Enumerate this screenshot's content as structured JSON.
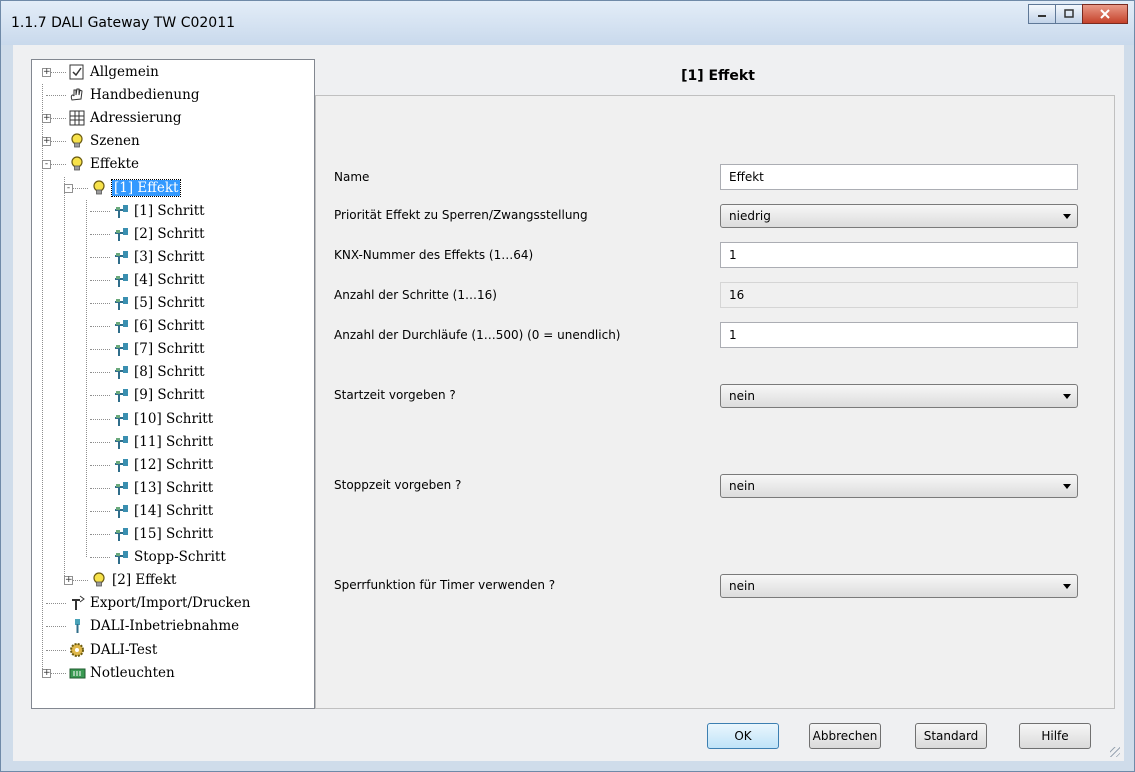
{
  "window": {
    "title": "1.1.7 DALI Gateway TW C02011",
    "controls": [
      "minimize-icon",
      "maximize-icon",
      "close-icon"
    ]
  },
  "tree": [
    {
      "label": "Allgemein",
      "icon": "checklist-icon",
      "expander": "+"
    },
    {
      "label": "Handbedienung",
      "icon": "hand-icon",
      "expander": ""
    },
    {
      "label": "Adressierung",
      "icon": "grid-icon",
      "expander": "+"
    },
    {
      "label": "Szenen",
      "icon": "lightbulb-icon",
      "expander": "+"
    },
    {
      "label": "Effekte",
      "icon": "lightbulb-icon",
      "expander": "-"
    },
    {
      "label": "[1] Effekt",
      "icon": "lightbulb-icon",
      "expander": "-",
      "selected": true
    },
    {
      "label": "[1] Schritt",
      "icon": "step-icon"
    },
    {
      "label": "[2] Schritt",
      "icon": "step-icon"
    },
    {
      "label": "[3] Schritt",
      "icon": "step-icon"
    },
    {
      "label": "[4] Schritt",
      "icon": "step-icon"
    },
    {
      "label": "[5] Schritt",
      "icon": "step-icon"
    },
    {
      "label": "[6] Schritt",
      "icon": "step-icon"
    },
    {
      "label": "[7] Schritt",
      "icon": "step-icon"
    },
    {
      "label": "[8] Schritt",
      "icon": "step-icon"
    },
    {
      "label": "[9] Schritt",
      "icon": "step-icon"
    },
    {
      "label": "[10] Schritt",
      "icon": "step-icon"
    },
    {
      "label": "[11] Schritt",
      "icon": "step-icon"
    },
    {
      "label": "[12] Schritt",
      "icon": "step-icon"
    },
    {
      "label": "[13] Schritt",
      "icon": "step-icon"
    },
    {
      "label": "[14] Schritt",
      "icon": "step-icon"
    },
    {
      "label": "[15] Schritt",
      "icon": "step-icon"
    },
    {
      "label": "Stopp-Schritt",
      "icon": "step-icon"
    },
    {
      "label": "[2] Effekt",
      "icon": "lightbulb-icon",
      "expander": "+"
    },
    {
      "label": "Export/Import/Drucken",
      "icon": "export-icon",
      "expander": ""
    },
    {
      "label": "DALI-Inbetriebnahme",
      "icon": "wrench-icon",
      "expander": ""
    },
    {
      "label": "DALI-Test",
      "icon": "gear-icon",
      "expander": ""
    },
    {
      "label": "Notleuchten",
      "icon": "emergency-light-icon",
      "expander": "+"
    }
  ],
  "panel": {
    "heading": "[1] Effekt",
    "params": [
      {
        "label": "Name",
        "type": "text",
        "value": "Effekt"
      },
      {
        "label": "Priorität Effekt zu Sperren/Zwangsstellung",
        "type": "select",
        "value": "niedrig"
      },
      {
        "label": "KNX-Nummer des Effekts (1…64)",
        "type": "text",
        "value": "1"
      },
      {
        "label": "Anzahl der Schritte (1…16)",
        "type": "readonly",
        "value": "16"
      },
      {
        "label": "Anzahl der Durchläufe (1…500) (0 = unendlich)",
        "type": "text",
        "value": "1"
      },
      {
        "label": "Startzeit vorgeben ?",
        "type": "select",
        "value": "nein"
      },
      {
        "label": "Stoppzeit vorgeben ?",
        "type": "select",
        "value": "nein"
      },
      {
        "label": "Sperrfunktion für Timer verwenden ?",
        "type": "select",
        "value": "nein"
      }
    ]
  },
  "buttons": {
    "ok": "OK",
    "cancel": "Abbrechen",
    "default": "Standard",
    "help": "Hilfe"
  },
  "colors": {
    "selection": "#3399ff",
    "titlebar": "#c9d9ec",
    "close": "#c5422b"
  }
}
